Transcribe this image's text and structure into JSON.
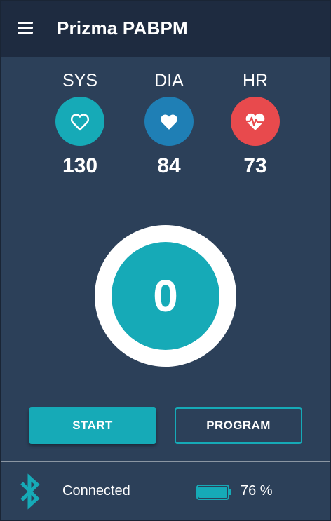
{
  "app": {
    "title": "Prizma PABPM"
  },
  "header": {
    "menu_icon": "hamburger-menu-icon"
  },
  "vitals": [
    {
      "key": "sys",
      "label": "SYS",
      "value": "130",
      "icon": "heart-outline-icon",
      "color": "#16aab7"
    },
    {
      "key": "dia",
      "label": "DIA",
      "value": "84",
      "icon": "heart-filled-icon",
      "color": "#1f7fb5"
    },
    {
      "key": "hr",
      "label": "HR",
      "value": "73",
      "icon": "heart-pulse-icon",
      "color": "#e84a4d"
    }
  ],
  "counter": {
    "value": "0"
  },
  "buttons": {
    "start_label": "START",
    "program_label": "PROGRAM"
  },
  "status": {
    "bluetooth_icon": "bluetooth-icon",
    "connection_text": "Connected",
    "battery_icon": "battery-icon",
    "battery_text": "76 %",
    "battery_level": 0.76
  },
  "colors": {
    "background": "#2c4059",
    "header": "#1e2b40",
    "accent": "#16aab7",
    "dia": "#1f7fb5",
    "hr": "#e84a4d"
  }
}
